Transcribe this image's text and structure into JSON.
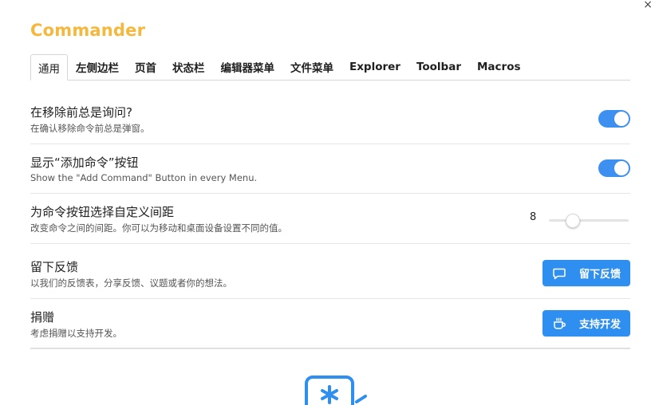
{
  "window": {
    "close_glyph": "×"
  },
  "brand": {
    "name": "Commander",
    "color": "#f5b83d"
  },
  "tabs": [
    {
      "label": "通用",
      "active": true
    },
    {
      "label": "左侧边栏"
    },
    {
      "label": "页首"
    },
    {
      "label": "状态栏"
    },
    {
      "label": "编辑器菜单"
    },
    {
      "label": "文件菜单"
    },
    {
      "label": "Explorer"
    },
    {
      "label": "Toolbar"
    },
    {
      "label": "Macros"
    }
  ],
  "settings": {
    "confirm_remove": {
      "title": "在移除前总是询问?",
      "description": "在确认移除命令前总是弹窗。",
      "enabled": true
    },
    "show_add_command": {
      "title": "显示“添加命令”按钮",
      "description": "Show the \"Add Command\" Button in every Menu.",
      "enabled": true
    },
    "spacing": {
      "title": "为命令按钮选择自定义间距",
      "description": "改变命令之间的间距。你可以为移动和桌面设备设置不同的值。",
      "value": "8",
      "slider_fraction": 0.3
    },
    "feedback": {
      "title": "留下反馈",
      "description": "以我们的反馈表，分享反馈、议题或者你的想法。",
      "button_label": "留下反馈",
      "button_icon": "message-icon"
    },
    "donate": {
      "title": "捐赠",
      "description": "考虑捐赠以支持开发。",
      "button_label": "支持开发",
      "button_icon": "coffee-icon"
    }
  },
  "colors": {
    "accent": "#3d8ff0",
    "button": "#2f8ff0"
  }
}
